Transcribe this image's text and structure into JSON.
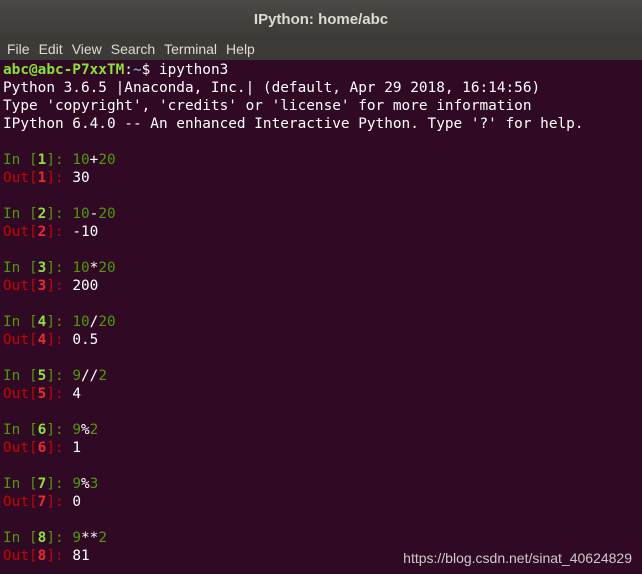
{
  "window": {
    "title": "IPython: home/abc"
  },
  "menu": [
    "File",
    "Edit",
    "View",
    "Search",
    "Terminal",
    "Help"
  ],
  "prompt": {
    "user": "abc@abc-P7xxTM",
    "sep": ":",
    "path": "~",
    "symbol": "$",
    "command": " ipython3"
  },
  "banner": [
    "Python 3.6.5 |Anaconda, Inc.| (default, Apr 29 2018, 16:14:56)",
    "Type 'copyright', 'credits' or 'license' for more information",
    "IPython 6.4.0 -- An enhanced Interactive Python. Type '?' for help."
  ],
  "cells": [
    {
      "n": "1",
      "a": "10",
      "op": "+",
      "b": "20",
      "out": "30"
    },
    {
      "n": "2",
      "a": "10",
      "op": "-",
      "b": "20",
      "out": "-10"
    },
    {
      "n": "3",
      "a": "10",
      "op": "*",
      "b": "20",
      "out": "200"
    },
    {
      "n": "4",
      "a": "10",
      "op": "/",
      "b": "20",
      "out": "0.5"
    },
    {
      "n": "5",
      "a": "9",
      "op": "//",
      "b": "2",
      "out": "4"
    },
    {
      "n": "6",
      "a": "9",
      "op": "%",
      "b": "2",
      "out": "1"
    },
    {
      "n": "7",
      "a": "9",
      "op": "%",
      "b": "3",
      "out": "0"
    },
    {
      "n": "8",
      "a": "9",
      "op": "**",
      "b": "2",
      "out": "81"
    }
  ],
  "labels": {
    "in": "In [",
    "out": "Out[",
    "close": "]: "
  },
  "watermark": "https://blog.csdn.net/sinat_40624829"
}
